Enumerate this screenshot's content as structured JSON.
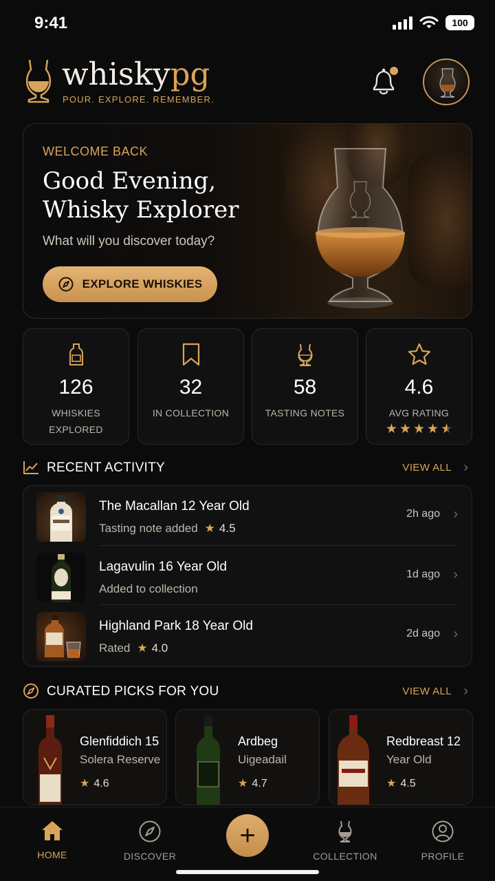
{
  "status_bar": {
    "time": "9:41",
    "battery": "100"
  },
  "brand": {
    "name_a": "whisky",
    "name_b": "pg",
    "tagline": "POUR. EXPLORE. REMEMBER."
  },
  "hero": {
    "eyebrow": "WELCOME BACK",
    "greeting_line1": "Good Evening,",
    "greeting_line2": "Whisky Explorer",
    "subtitle": "What will you discover today?",
    "cta_label": "EXPLORE WHISKIES"
  },
  "stats": [
    {
      "icon": "bottle-icon",
      "value": "126",
      "label": "WHISKIES EXPLORED"
    },
    {
      "icon": "bookmark-icon",
      "value": "32",
      "label": "IN COLLECTION"
    },
    {
      "icon": "glass-icon",
      "value": "58",
      "label": "TASTING NOTES"
    },
    {
      "icon": "star-icon",
      "value": "4.6",
      "label": "AVG RATING",
      "stars": 4.6
    }
  ],
  "recent_activity": {
    "title": "RECENT ACTIVITY",
    "view_all": "VIEW ALL",
    "items": [
      {
        "name": "The Macallan 12 Year Old",
        "action": "Tasting note added",
        "rating": "4.5",
        "time": "2h ago"
      },
      {
        "name": "Lagavulin 16 Year Old",
        "action": "Added to collection",
        "rating": "",
        "time": "1d ago"
      },
      {
        "name": "Highland Park 18 Year Old",
        "action": "Rated",
        "rating": "4.0",
        "time": "2d ago"
      }
    ]
  },
  "curated": {
    "title": "CURATED PICKS FOR YOU",
    "view_all": "VIEW ALL",
    "items": [
      {
        "name": "Glenfiddich 15",
        "sub": "Solera Reserve",
        "rating": "4.6"
      },
      {
        "name": "Ardbeg",
        "sub": "Uigeadail",
        "rating": "4.7"
      },
      {
        "name": "Redbreast 12",
        "sub": "Year Old",
        "rating": "4.5"
      }
    ]
  },
  "nav": {
    "home": "HOME",
    "discover": "DISCOVER",
    "collection": "COLLECTION",
    "profile": "PROFILE"
  },
  "colors": {
    "accent": "#d9a45a",
    "background": "#0b0b0b",
    "card": "#111111"
  }
}
